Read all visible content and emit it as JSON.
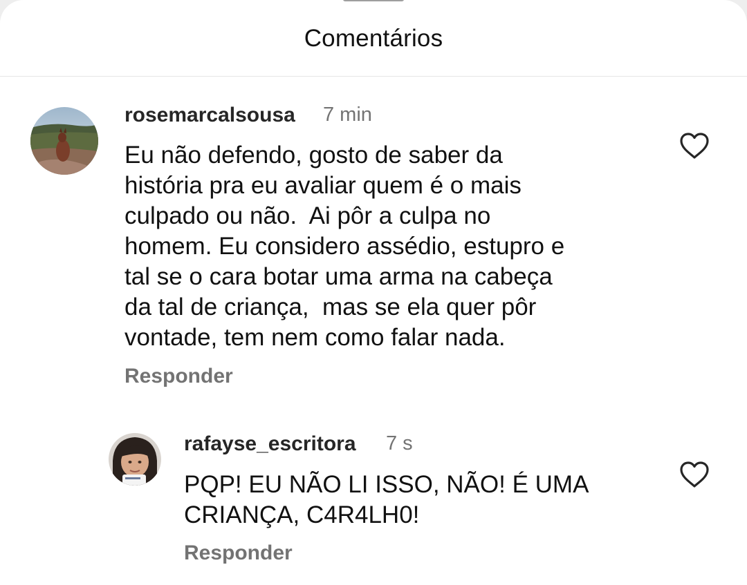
{
  "header": {
    "title": "Comentários"
  },
  "comments": [
    {
      "username": "rosemarcalsousa",
      "time": "7 min",
      "text": "Eu não defendo, gosto de saber da\nhistória pra eu avaliar quem é o mais\nculpado ou não.  Ai pôr a culpa no\nhomem. Eu considero assédio, estupro e\ntal se o cara botar uma arma na cabeça\nda tal de criança,  mas se ela quer pôr\nvontade, tem nem como falar nada.",
      "reply_label": "Responder",
      "like_icon": "heart-outline-icon"
    },
    {
      "username": "rafayse_escritora",
      "time": "7 s",
      "text": "PQP! EU NÃO LI ISSO, NÃO! É UMA\nCRIANÇA, C4R4LH0!",
      "reply_label": "Responder",
      "like_icon": "heart-outline-icon"
    }
  ],
  "colors": {
    "background": "#ffffff",
    "text_primary": "#111111",
    "text_secondary": "#737373",
    "divider": "#e6e6e6"
  }
}
